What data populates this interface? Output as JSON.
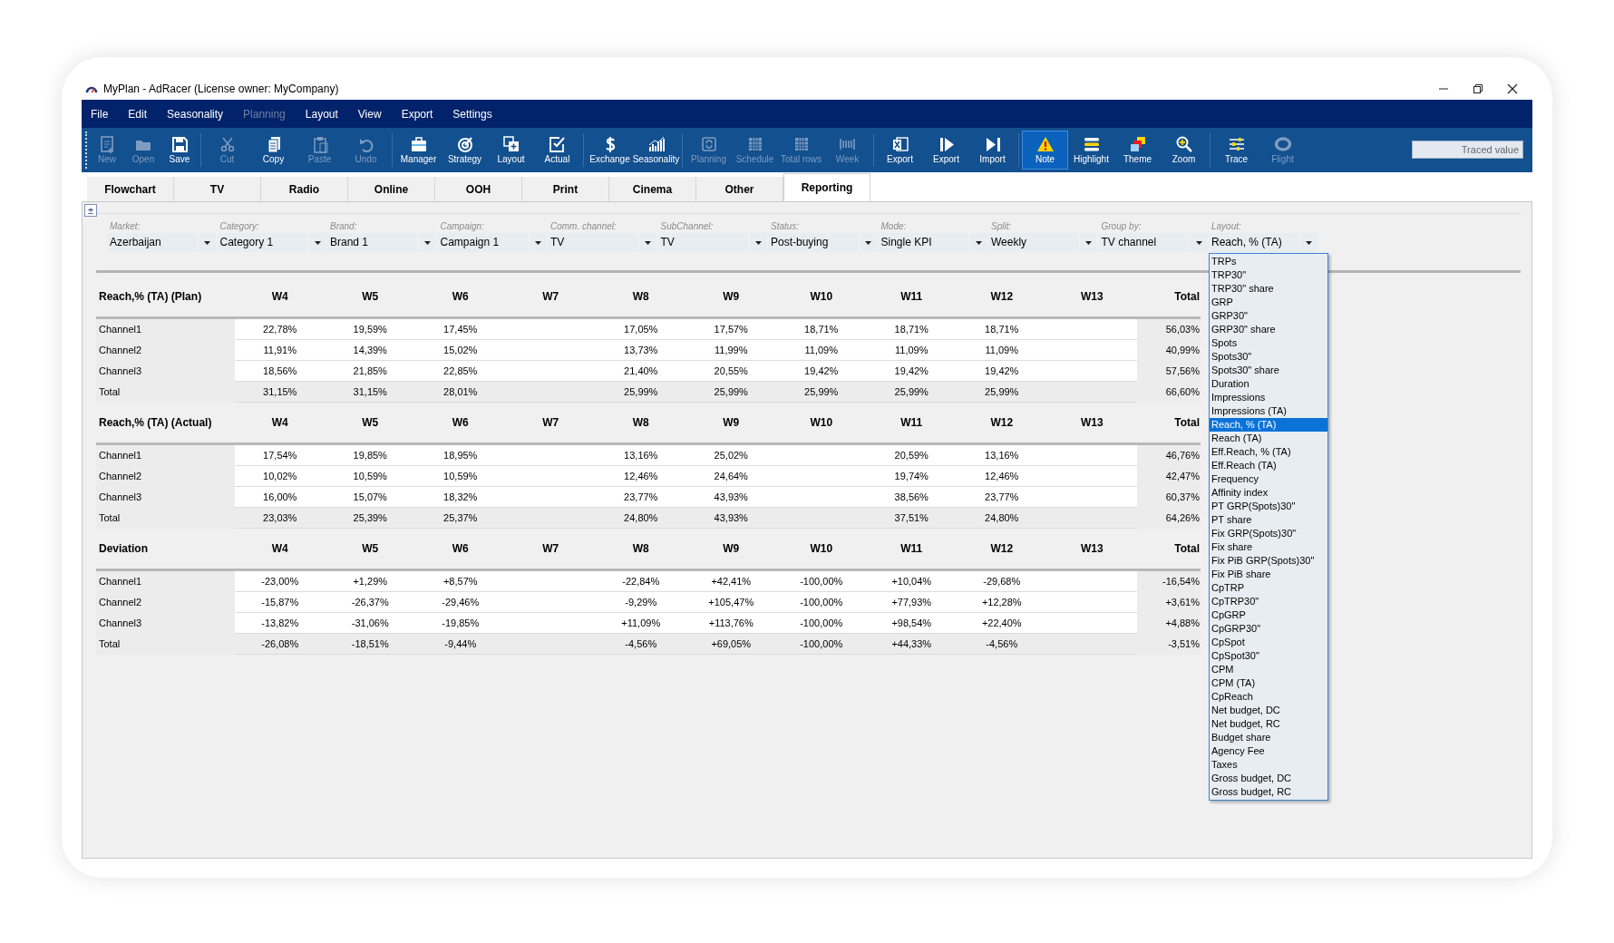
{
  "window": {
    "title": "MyPlan - AdRacer (License owner: MyCompany)"
  },
  "menu": [
    {
      "label": "File",
      "disabled": false
    },
    {
      "label": "Edit",
      "disabled": false
    },
    {
      "label": "Seasonality",
      "disabled": false
    },
    {
      "label": "Planning",
      "disabled": true
    },
    {
      "label": "Layout",
      "disabled": false
    },
    {
      "label": "View",
      "disabled": false
    },
    {
      "label": "Export",
      "disabled": false
    },
    {
      "label": "Settings",
      "disabled": false
    }
  ],
  "toolbar": [
    [
      {
        "label": "New",
        "kind": "new",
        "disabled": true,
        "selected": false
      },
      {
        "label": "Open",
        "kind": "open",
        "disabled": true,
        "selected": false
      },
      {
        "label": "Save",
        "kind": "save",
        "disabled": false,
        "selected": false
      }
    ],
    [
      {
        "label": "Cut",
        "kind": "cut",
        "disabled": true,
        "selected": false
      },
      {
        "label": "Copy",
        "kind": "copy",
        "disabled": false,
        "selected": false
      },
      {
        "label": "Paste",
        "kind": "paste",
        "disabled": true,
        "selected": false
      },
      {
        "label": "Undo",
        "kind": "undo",
        "disabled": true,
        "selected": false
      }
    ],
    [
      {
        "label": "Manager",
        "kind": "briefcase",
        "disabled": false,
        "selected": false
      },
      {
        "label": "Strategy",
        "kind": "target",
        "disabled": false,
        "selected": false
      },
      {
        "label": "Layout",
        "kind": "layers",
        "disabled": false,
        "selected": false
      },
      {
        "label": "Actual",
        "kind": "check",
        "disabled": false,
        "selected": false
      }
    ],
    [
      {
        "label": "Exchange",
        "kind": "dollar",
        "disabled": false,
        "selected": false
      },
      {
        "label": "Seasonality",
        "kind": "chart",
        "disabled": false,
        "selected": false
      }
    ],
    [
      {
        "label": "Planning",
        "kind": "refresh",
        "disabled": true,
        "selected": false
      },
      {
        "label": "Schedule",
        "kind": "grid",
        "disabled": true,
        "selected": false
      },
      {
        "label": "Total rows",
        "kind": "grid",
        "disabled": true,
        "selected": false
      },
      {
        "label": "Week",
        "kind": "bars",
        "disabled": true,
        "selected": false
      }
    ],
    [
      {
        "label": "Export",
        "kind": "excel",
        "disabled": false,
        "selected": false
      },
      {
        "label": "Export",
        "kind": "play",
        "disabled": false,
        "selected": false
      },
      {
        "label": "Import",
        "kind": "skip",
        "disabled": false,
        "selected": false
      }
    ],
    [
      {
        "label": "Note",
        "kind": "warning",
        "disabled": false,
        "selected": true
      },
      {
        "label": "Highlight",
        "kind": "lines",
        "disabled": false,
        "selected": false
      },
      {
        "label": "Theme",
        "kind": "squares",
        "disabled": false,
        "selected": false
      },
      {
        "label": "Zoom",
        "kind": "zoom",
        "disabled": false,
        "selected": false
      }
    ],
    [
      {
        "label": "Trace",
        "kind": "sliders",
        "disabled": false,
        "selected": false
      },
      {
        "label": "Flight",
        "kind": "ring",
        "disabled": true,
        "selected": false
      }
    ]
  ],
  "traced_field": {
    "placeholder": "Traced value"
  },
  "tabs": [
    {
      "label": "Flowchart",
      "selected": false
    },
    {
      "label": "TV",
      "selected": false
    },
    {
      "label": "Radio",
      "selected": false
    },
    {
      "label": "Online",
      "selected": false
    },
    {
      "label": "OOH",
      "selected": false
    },
    {
      "label": "Print",
      "selected": false
    },
    {
      "label": "Cinema",
      "selected": false
    },
    {
      "label": "Other",
      "selected": false
    },
    {
      "label": "Reporting",
      "selected": true
    }
  ],
  "toggle_button": "±",
  "filters": [
    {
      "label": "Market:",
      "value": "Azerbaijan"
    },
    {
      "label": "Category:",
      "value": "Category 1"
    },
    {
      "label": "Brand:",
      "value": "Brand 1"
    },
    {
      "label": "Campaign:",
      "value": "Campaign 1"
    },
    {
      "label": "Comm. channel:",
      "value": "TV"
    },
    {
      "label": "SubChannel:",
      "value": "TV"
    },
    {
      "label": "Status:",
      "value": "Post-buying"
    },
    {
      "label": "Mode:",
      "value": "Single KPI"
    },
    {
      "label": "Split:",
      "value": "Weekly"
    },
    {
      "label": "Group by:",
      "value": "TV channel"
    },
    {
      "label": "Layout:",
      "value": "Reach, % (TA)",
      "options": [
        {
          "label": "TRPs",
          "selected": false
        },
        {
          "label": "TRP30\"",
          "selected": false
        },
        {
          "label": "TRP30\" share",
          "selected": false
        },
        {
          "label": "GRP",
          "selected": false
        },
        {
          "label": "GRP30\"",
          "selected": false
        },
        {
          "label": "GRP30\" share",
          "selected": false
        },
        {
          "label": "Spots",
          "selected": false
        },
        {
          "label": "Spots30\"",
          "selected": false
        },
        {
          "label": "Spots30\" share",
          "selected": false
        },
        {
          "label": "Duration",
          "selected": false
        },
        {
          "label": "Impressions",
          "selected": false
        },
        {
          "label": "Impressions (TA)",
          "selected": false
        },
        {
          "label": "Reach, % (TA)",
          "selected": true
        },
        {
          "label": "Reach (TA)",
          "selected": false
        },
        {
          "label": "Eff.Reach, % (TA)",
          "selected": false
        },
        {
          "label": "Eff.Reach (TA)",
          "selected": false
        },
        {
          "label": "Frequency",
          "selected": false
        },
        {
          "label": "Affinity index",
          "selected": false
        },
        {
          "label": "PT GRP(Spots)30\"",
          "selected": false
        },
        {
          "label": "PT share",
          "selected": false
        },
        {
          "label": "Fix GRP(Spots)30\"",
          "selected": false
        },
        {
          "label": "Fix share",
          "selected": false
        },
        {
          "label": "Fix PiB GRP(Spots)30\"",
          "selected": false
        },
        {
          "label": "Fix PiB share",
          "selected": false
        },
        {
          "label": "CpTRP",
          "selected": false
        },
        {
          "label": "CpTRP30\"",
          "selected": false
        },
        {
          "label": "CpGRP",
          "selected": false
        },
        {
          "label": "CpGRP30\"",
          "selected": false
        },
        {
          "label": "CpSpot",
          "selected": false
        },
        {
          "label": "CpSpot30\"",
          "selected": false
        },
        {
          "label": "CPM",
          "selected": false
        },
        {
          "label": "CPM (TA)",
          "selected": false
        },
        {
          "label": "CpReach",
          "selected": false
        },
        {
          "label": "Net budget, DC",
          "selected": false
        },
        {
          "label": "Net budget, RC",
          "selected": false
        },
        {
          "label": "Budget share",
          "selected": false
        },
        {
          "label": "Agency Fee",
          "selected": false
        },
        {
          "label": "Taxes",
          "selected": false
        },
        {
          "label": "Gross budget, DC",
          "selected": false
        },
        {
          "label": "Gross budget, RC",
          "selected": false
        }
      ]
    }
  ],
  "sections": [
    {
      "title": "Reach,% (TA) (Plan)",
      "columns": [
        "W4",
        "W5",
        "W6",
        "W7",
        "W8",
        "W9",
        "W10",
        "W11",
        "W12",
        "W13",
        "Total"
      ],
      "rows": [
        {
          "label": "Channel1",
          "kind": "channel",
          "values": {
            "w4": "22,78%",
            "w5": "19,59%",
            "w6": "17,45%",
            "w8": "17,05%",
            "w9": "17,57%",
            "w10": "18,71%",
            "w11": "18,71%",
            "w12": "18,71%",
            "total": "56,03%"
          }
        },
        {
          "label": "Channel2",
          "kind": "channel",
          "values": {
            "w4": "11,91%",
            "w5": "14,39%",
            "w6": "15,02%",
            "w8": "13,73%",
            "w9": "11,99%",
            "w10": "11,09%",
            "w11": "11,09%",
            "w12": "11,09%",
            "total": "40,99%"
          }
        },
        {
          "label": "Channel3",
          "kind": "channel",
          "values": {
            "w4": "18,56%",
            "w5": "21,85%",
            "w6": "22,85%",
            "w8": "21,40%",
            "w9": "20,55%",
            "w10": "19,42%",
            "w11": "19,42%",
            "w12": "19,42%",
            "total": "57,56%"
          }
        },
        {
          "label": "Total",
          "kind": "total",
          "values": {
            "w4": "31,15%",
            "w5": "31,15%",
            "w6": "28,01%",
            "w8": "25,99%",
            "w9": "25,99%",
            "w10": "25,99%",
            "w11": "25,99%",
            "w12": "25,99%",
            "total": "66,60%"
          }
        }
      ]
    },
    {
      "title": "Reach,% (TA) (Actual)",
      "columns": [
        "W4",
        "W5",
        "W6",
        "W7",
        "W8",
        "W9",
        "W10",
        "W11",
        "W12",
        "W13",
        "Total"
      ],
      "rows": [
        {
          "label": "Channel1",
          "kind": "channel",
          "values": {
            "w4": "17,54%",
            "w5": "19,85%",
            "w6": "18,95%",
            "w8": "13,16%",
            "w9": "25,02%",
            "w11": "20,59%",
            "w12": "13,16%",
            "total": "46,76%"
          }
        },
        {
          "label": "Channel2",
          "kind": "channel",
          "values": {
            "w4": "10,02%",
            "w5": "10,59%",
            "w6": "10,59%",
            "w8": "12,46%",
            "w9": "24,64%",
            "w11": "19,74%",
            "w12": "12,46%",
            "total": "42,47%"
          }
        },
        {
          "label": "Channel3",
          "kind": "channel",
          "values": {
            "w4": "16,00%",
            "w5": "15,07%",
            "w6": "18,32%",
            "w8": "23,77%",
            "w9": "43,93%",
            "w11": "38,56%",
            "w12": "23,77%",
            "total": "60,37%"
          }
        },
        {
          "label": "Total",
          "kind": "total",
          "values": {
            "w4": "23,03%",
            "w5": "25,39%",
            "w6": "25,37%",
            "w8": "24,80%",
            "w9": "43,93%",
            "w11": "37,51%",
            "w12": "24,80%",
            "total": "64,26%"
          }
        }
      ]
    },
    {
      "title": "Deviation",
      "columns": [
        "W4",
        "W5",
        "W6",
        "W7",
        "W8",
        "W9",
        "W10",
        "W11",
        "W12",
        "W13",
        "Total"
      ],
      "rows": [
        {
          "label": "Channel1",
          "kind": "channel",
          "values": {
            "w4": "-23,00%",
            "w5": "+1,29%",
            "w6": "+8,57%",
            "w8": "-22,84%",
            "w9": "+42,41%",
            "w10": "-100,00%",
            "w11": "+10,04%",
            "w12": "-29,68%",
            "total": "-16,54%"
          }
        },
        {
          "label": "Channel2",
          "kind": "channel",
          "values": {
            "w4": "-15,87%",
            "w5": "-26,37%",
            "w6": "-29,46%",
            "w8": "-9,29%",
            "w9": "+105,47%",
            "w10": "-100,00%",
            "w11": "+77,93%",
            "w12": "+12,28%",
            "total": "+3,61%"
          }
        },
        {
          "label": "Channel3",
          "kind": "channel",
          "values": {
            "w4": "-13,82%",
            "w5": "-31,06%",
            "w6": "-19,85%",
            "w8": "+11,09%",
            "w9": "+113,76%",
            "w10": "-100,00%",
            "w11": "+98,54%",
            "w12": "+22,40%",
            "total": "+4,88%"
          }
        },
        {
          "label": "Total",
          "kind": "total",
          "values": {
            "w4": "-26,08%",
            "w5": "-18,51%",
            "w6": "-9,44%",
            "w8": "-4,56%",
            "w9": "+69,05%",
            "w10": "-100,00%",
            "w11": "+44,33%",
            "w12": "-4,56%",
            "total": "-3,51%"
          }
        }
      ]
    }
  ]
}
